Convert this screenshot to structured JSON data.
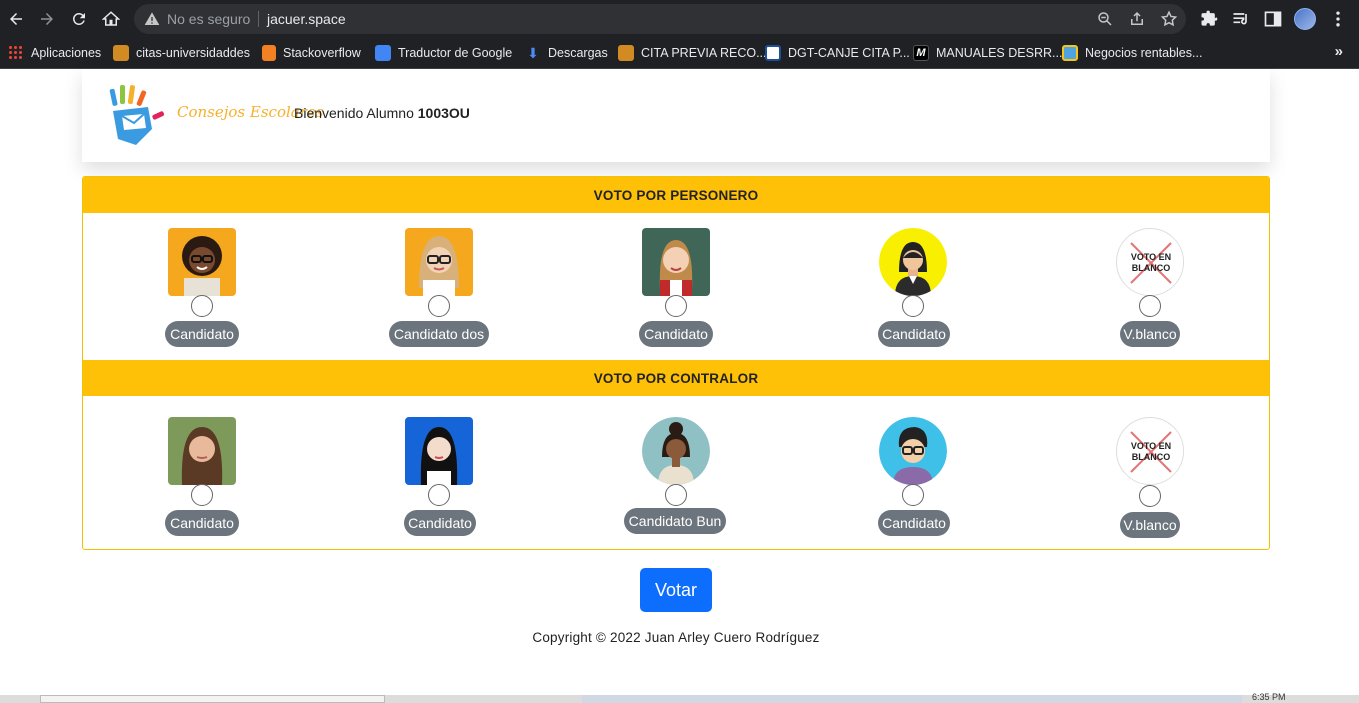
{
  "browser": {
    "security_label": "No es seguro",
    "url": "jacuer.space",
    "bookmarks": [
      {
        "label": "Aplicaciones",
        "color": "#e94235"
      },
      {
        "label": "citas-universidaddes",
        "color": "#d28b22"
      },
      {
        "label": "Stackoverflow",
        "color": "#f48024"
      },
      {
        "label": "Traductor de Google",
        "color": "#4285f4"
      },
      {
        "label": "Descargas",
        "color": "#4c8bf5"
      },
      {
        "label": "CITA PREVIA RECO...",
        "color": "#d28b22"
      },
      {
        "label": "DGT-CANJE CITA P...",
        "color": "#1c4f9c"
      },
      {
        "label": "MANUALES DESRR...",
        "color": "#000000"
      },
      {
        "label": "Negocios rentables...",
        "color": "#f5c518"
      }
    ]
  },
  "header": {
    "brand": "Consejos Escolares",
    "welcome_prefix": "Bienvenido Alumno",
    "student_code": "1003OU"
  },
  "personero": {
    "title": "VOTO POR PERSONERO",
    "candidates": [
      {
        "label": "Candidato",
        "icon": "girl-curly-hair-glasses-photo"
      },
      {
        "label": "Candidato dos",
        "icon": "girl-blonde-glasses-photo"
      },
      {
        "label": "Candidato",
        "icon": "girl-braids-chalkboard-photo"
      },
      {
        "label": "Candidato",
        "icon": "woman-avatar-yellow-icon"
      },
      {
        "label": "V.blanco",
        "icon": "voto-en-blanco-icon"
      }
    ]
  },
  "contralor": {
    "title": "VOTO POR CONTRALOR",
    "candidates": [
      {
        "label": "Candidato",
        "icon": "girl-long-hair-photo"
      },
      {
        "label": "Candidato",
        "icon": "girl-blue-background-photo"
      },
      {
        "label": "Candidato Bun",
        "icon": "woman-bun-avatar-icon"
      },
      {
        "label": "Candidato",
        "icon": "man-glasses-avatar-icon"
      },
      {
        "label": "V.blanco",
        "icon": "voto-en-blanco-icon"
      }
    ]
  },
  "blank_vote_text": {
    "line1": "VOTO EN",
    "line2": "BLANCO"
  },
  "submit_label": "Votar",
  "footer": {
    "copyright": "Copyright © 2022 Juan Arley Cuero Rodríguez"
  },
  "taskbar": {
    "clock": "6:35 PM"
  },
  "colors": {
    "section_bar": "#ffc107",
    "submit": "#0d6efd",
    "pill": "#6c757d"
  }
}
